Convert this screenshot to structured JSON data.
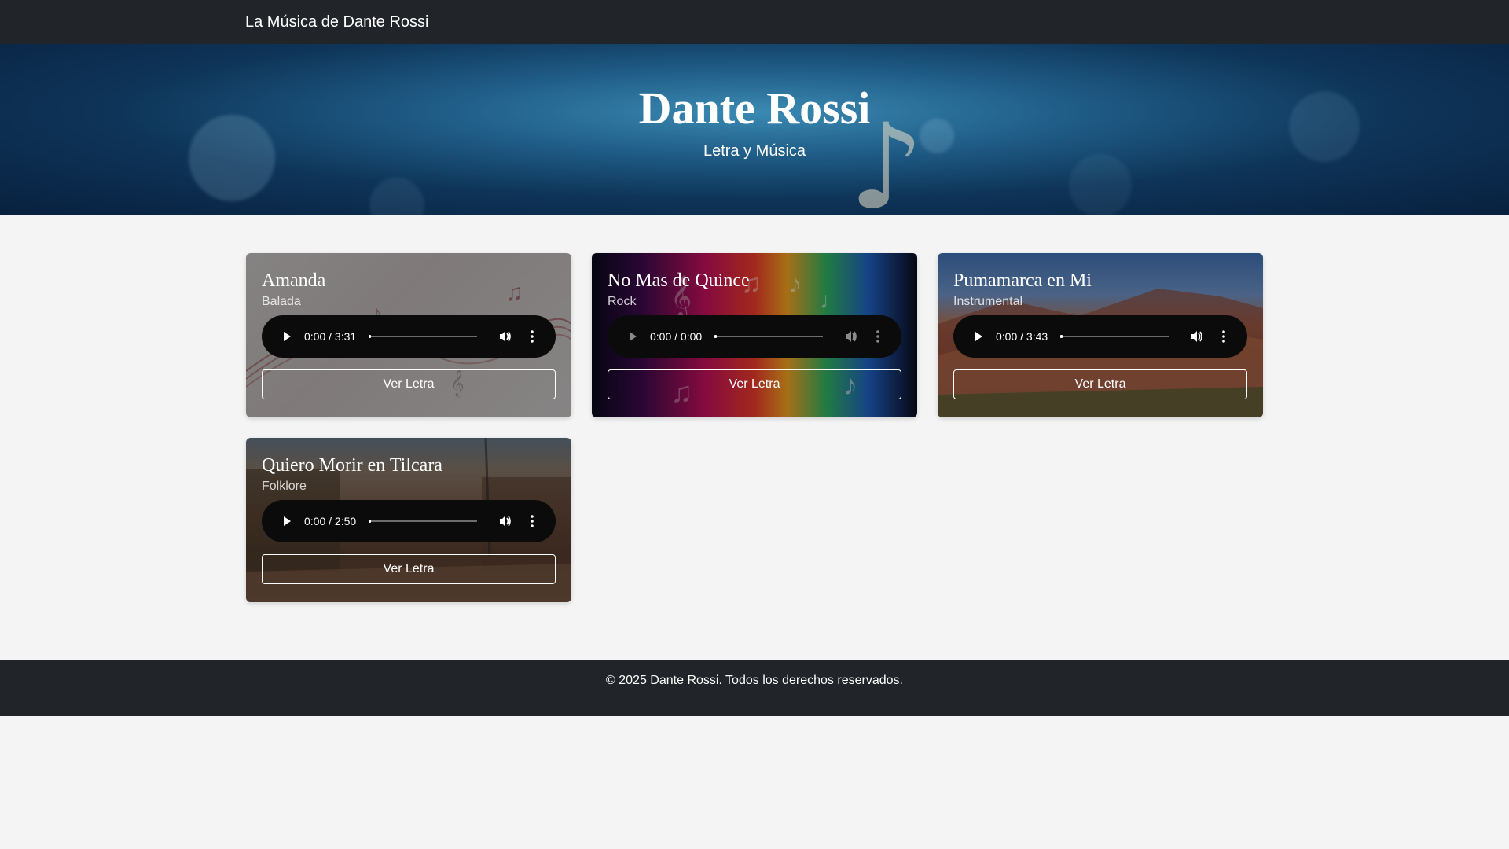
{
  "navbar": {
    "brand": "La Música de Dante Rossi"
  },
  "hero": {
    "title": "Dante Rossi",
    "subtitle": "Letra y Música"
  },
  "songs": [
    {
      "title": "Amanda",
      "genre": "Balada",
      "time": "0:00 / 3:31",
      "button": "Ver Letra",
      "disabled": false
    },
    {
      "title": "No Mas de Quince",
      "genre": "Rock",
      "time": "0:00 / 0:00",
      "button": "Ver Letra",
      "disabled": true
    },
    {
      "title": "Pumamarca en Mi",
      "genre": "Instrumental",
      "time": "0:00 / 3:43",
      "button": "Ver Letra",
      "disabled": false
    },
    {
      "title": "Quiero Morir en Tilcara",
      "genre": "Folklore",
      "time": "0:00 / 2:50",
      "button": "Ver Letra",
      "disabled": false
    }
  ],
  "footer": {
    "text": "© 2025 Dante Rossi. Todos los derechos reservados."
  },
  "colors": {
    "navbar": "#212529",
    "footer": "#212529",
    "page_bg": "#f4f4f4",
    "hero_blue": "#1f5c86"
  }
}
